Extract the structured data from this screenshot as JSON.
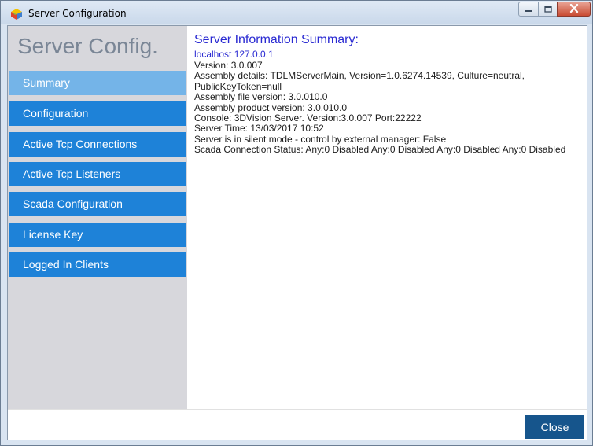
{
  "window": {
    "title": "Server Configuration"
  },
  "sidebar": {
    "title": "Server Config.",
    "items": [
      {
        "label": "Summary",
        "active": true
      },
      {
        "label": "Configuration",
        "active": false
      },
      {
        "label": "Active Tcp Connections",
        "active": false
      },
      {
        "label": "Active Tcp Listeners",
        "active": false
      },
      {
        "label": "Scada Configuration",
        "active": false
      },
      {
        "label": "License Key",
        "active": false
      },
      {
        "label": "Logged In Clients",
        "active": false
      }
    ]
  },
  "summary": {
    "title": "Server Information Summary:",
    "host": "localhost 127.0.0.1",
    "lines": [
      "Version: 3.0.007",
      "Assembly details: TDLMServerMain, Version=1.0.6274.14539, Culture=neutral, PublicKeyToken=null",
      "Assembly file version: 3.0.010.0",
      "Assembly product version: 3.0.010.0",
      "Console: 3DVision Server. Version:3.0.007 Port:22222",
      "Server Time: 13/03/2017 10:52",
      "Server is in silent mode - control by external manager: False",
      "Scada Connection Status: Any:0 Disabled Any:0 Disabled Any:0 Disabled Any:0 Disabled"
    ]
  },
  "footer": {
    "close_label": "Close"
  },
  "colors": {
    "nav_item": "#1e82d8",
    "nav_item_active": "#74b4e8",
    "summary_title": "#2a2ad2",
    "close_button": "#16558c",
    "sidebar_bg": "#d7d7dc"
  },
  "icons": {
    "app": "server-app-icon",
    "minimize": "minimize-icon",
    "maximize": "maximize-icon",
    "close": "close-x-icon"
  }
}
